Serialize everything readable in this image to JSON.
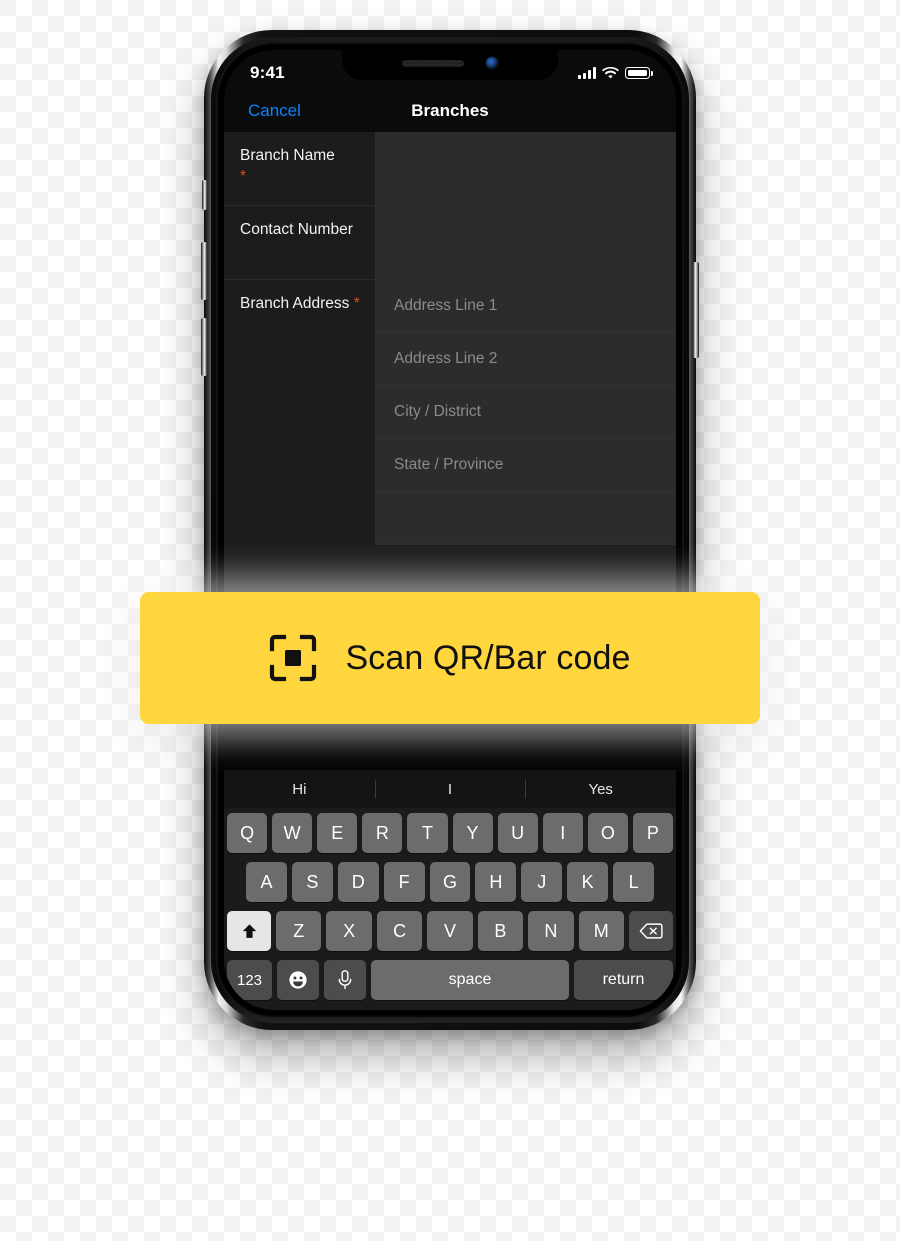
{
  "status_bar": {
    "time": "9:41",
    "signal_icon": "cellular-signal-icon",
    "wifi_icon": "wifi-icon",
    "battery_icon": "battery-icon"
  },
  "nav_bar": {
    "cancel_label": "Cancel",
    "title": "Branches"
  },
  "form": {
    "rows": [
      {
        "label": "Branch Name",
        "required": true,
        "required_mark": "*",
        "value": "",
        "placeholder": ""
      },
      {
        "label": "Contact Number",
        "required": false,
        "required_mark": "",
        "value": "",
        "placeholder": ""
      }
    ],
    "address": {
      "label": "Branch Address",
      "required": true,
      "required_mark": "*",
      "fields": [
        {
          "placeholder": "Address Line 1",
          "value": ""
        },
        {
          "placeholder": "Address Line 2",
          "value": ""
        },
        {
          "placeholder": "City / District",
          "value": ""
        },
        {
          "placeholder": "State / Province",
          "value": ""
        }
      ]
    }
  },
  "scan_banner": {
    "label": "Scan QR/Bar code",
    "icon": "qr-scan-icon",
    "background_color": "#FFD63D",
    "text_color": "#111111"
  },
  "keyboard": {
    "suggestions": [
      "Hi",
      "I",
      "Yes"
    ],
    "row1": [
      "Q",
      "W",
      "E",
      "R",
      "T",
      "Y",
      "U",
      "I",
      "O",
      "P"
    ],
    "row2": [
      "A",
      "S",
      "D",
      "F",
      "G",
      "H",
      "J",
      "K",
      "L"
    ],
    "row3": [
      "Z",
      "X",
      "C",
      "V",
      "B",
      "N",
      "M"
    ],
    "shift_label": "",
    "backspace_label": "",
    "numbers_label": "123",
    "emoji_label": "",
    "dictation_label": "",
    "space_label": "space",
    "return_label": "return"
  },
  "colors": {
    "accent_blue": "#0A84FF",
    "required_red": "#E0462F",
    "brand_yellow": "#FFD63D",
    "label_bg": "#1C1C1C",
    "input_bg": "#2C2C2C"
  }
}
